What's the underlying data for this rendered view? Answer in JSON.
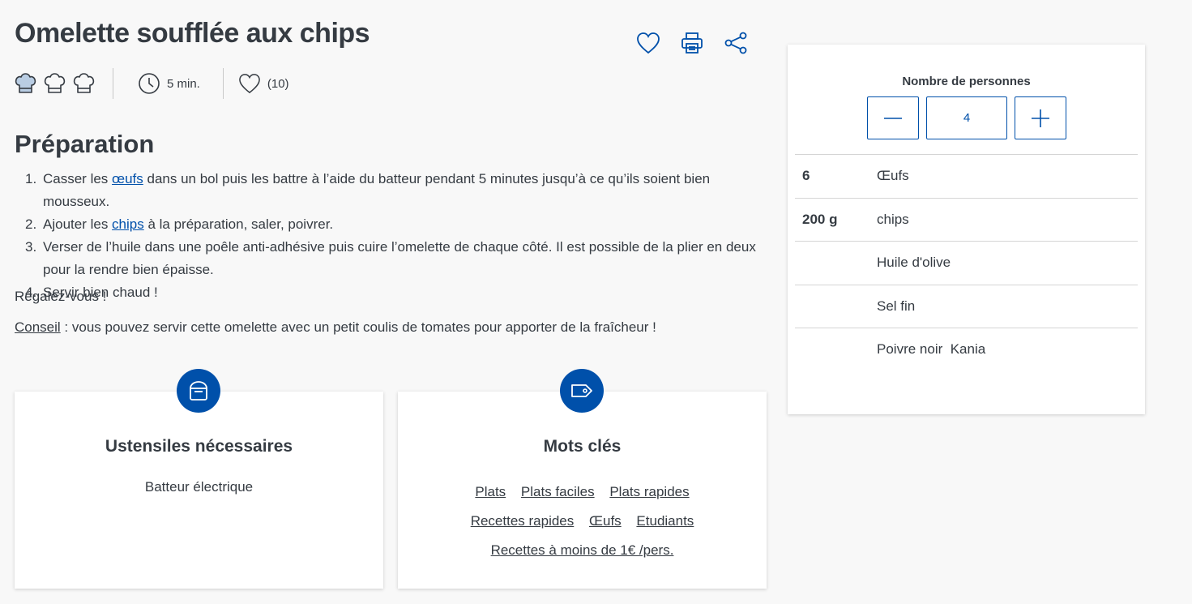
{
  "recipe": {
    "title": "Omelette soufflée aux chips",
    "time": "5 min.",
    "likes": "(10)",
    "difficulty": 1
  },
  "preparation": {
    "title": "Préparation",
    "steps": [
      {
        "num": "1.",
        "before": "Casser les ",
        "link": "œufs",
        "after": " dans un bol puis les battre à l’aide du batteur pendant 5 minutes jusqu’à ce qu’ils soient bien mousseux."
      },
      {
        "num": "2.",
        "before": "Ajouter les ",
        "link": "chips",
        "after": " à la préparation, saler, poivrer."
      },
      {
        "num": "3.",
        "before": "Verser de l’huile dans une poêle anti-adhésive puis cuire l’omelette de chaque côté. Il est possible de la plier en deux pour la rendre bien épaisse.",
        "link": "",
        "after": ""
      },
      {
        "num": "4.",
        "before": "Servir bien chaud !",
        "link": "",
        "after": ""
      }
    ],
    "regalez": "Régalez-vous !",
    "conseil_label": "Conseil",
    "conseil_text": " : vous pouvez servir cette omelette avec un petit coulis de tomates pour apporter de la fraîcheur !"
  },
  "utensils": {
    "title": "Ustensiles nécessaires",
    "items": "Batteur électrique"
  },
  "keywords": {
    "title": "Mots clés",
    "rows": [
      [
        "Plats",
        "Plats faciles",
        "Plats rapides"
      ],
      [
        "Recettes rapides",
        "Œufs",
        "Etudiants"
      ],
      [
        "Recettes à moins de 1€ /pers."
      ]
    ]
  },
  "ingredients": {
    "persons_label": "Nombre de personnes",
    "persons": "4",
    "items": [
      {
        "qty": "6",
        "name": "Œufs"
      },
      {
        "qty": "200 g",
        "name": "chips"
      },
      {
        "qty": "",
        "name": "Huile d'olive"
      },
      {
        "qty": "",
        "name": "Sel fin"
      },
      {
        "qty": "",
        "name": "Poivre noir  Kania"
      }
    ]
  },
  "colors": {
    "accent": "#0050aa",
    "text": "#353b42",
    "background": "#f8f8f8"
  },
  "icons": [
    "heart-icon",
    "print-icon",
    "share-icon",
    "chef-hat-icon",
    "clock-icon",
    "pot-icon",
    "tag-icon",
    "minus-icon",
    "plus-icon"
  ]
}
